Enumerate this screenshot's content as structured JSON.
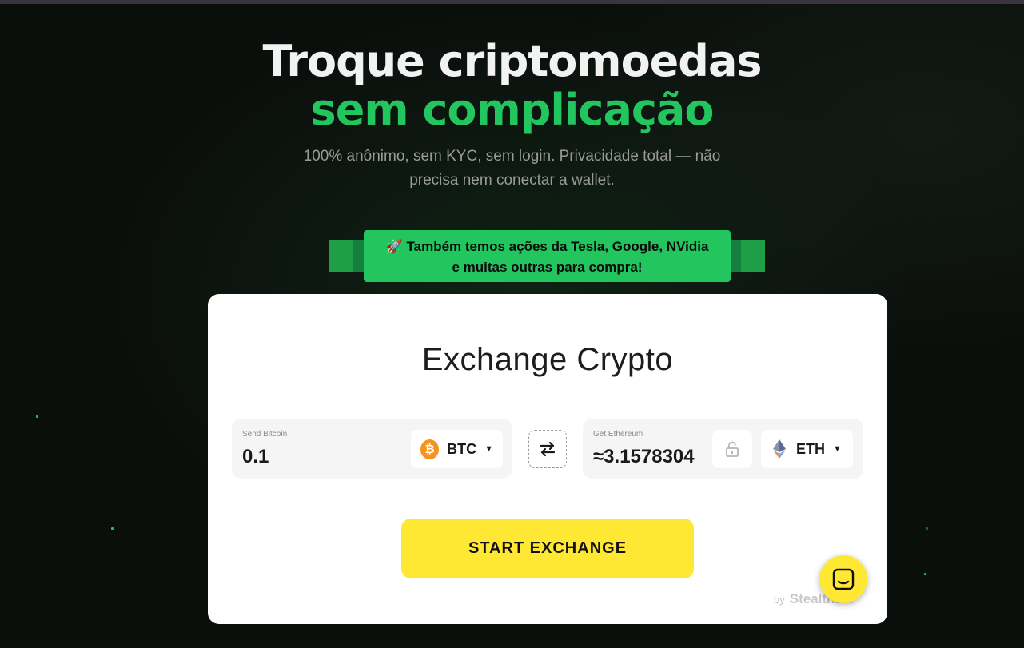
{
  "hero": {
    "title_line1": "Troque criptomoedas",
    "title_line2": "sem complicação",
    "subtitle_line1": "100% anônimo, sem KYC, sem login. Privacidade total — não",
    "subtitle_line2": "precisa nem conectar a wallet."
  },
  "banner": {
    "emoji": "🚀",
    "line1": "Também temos ações da Tesla, Google, NVidia",
    "line2": "e muitas outras para compra!"
  },
  "exchange": {
    "title": "Exchange Crypto",
    "send": {
      "label": "Send Bitcoin",
      "value": "0.1",
      "coin": "BTC",
      "coin_icon": "bitcoin-icon"
    },
    "get": {
      "label": "Get Ethereum",
      "value": "≈3.1578304",
      "coin": "ETH",
      "coin_icon": "ethereum-icon"
    },
    "start_button": "START EXCHANGE",
    "powered_by": "by",
    "brand": "StealthEX"
  },
  "colors": {
    "accent_green": "#22c55e",
    "button_yellow": "#ffe834",
    "bitcoin_orange": "#f7931a"
  }
}
